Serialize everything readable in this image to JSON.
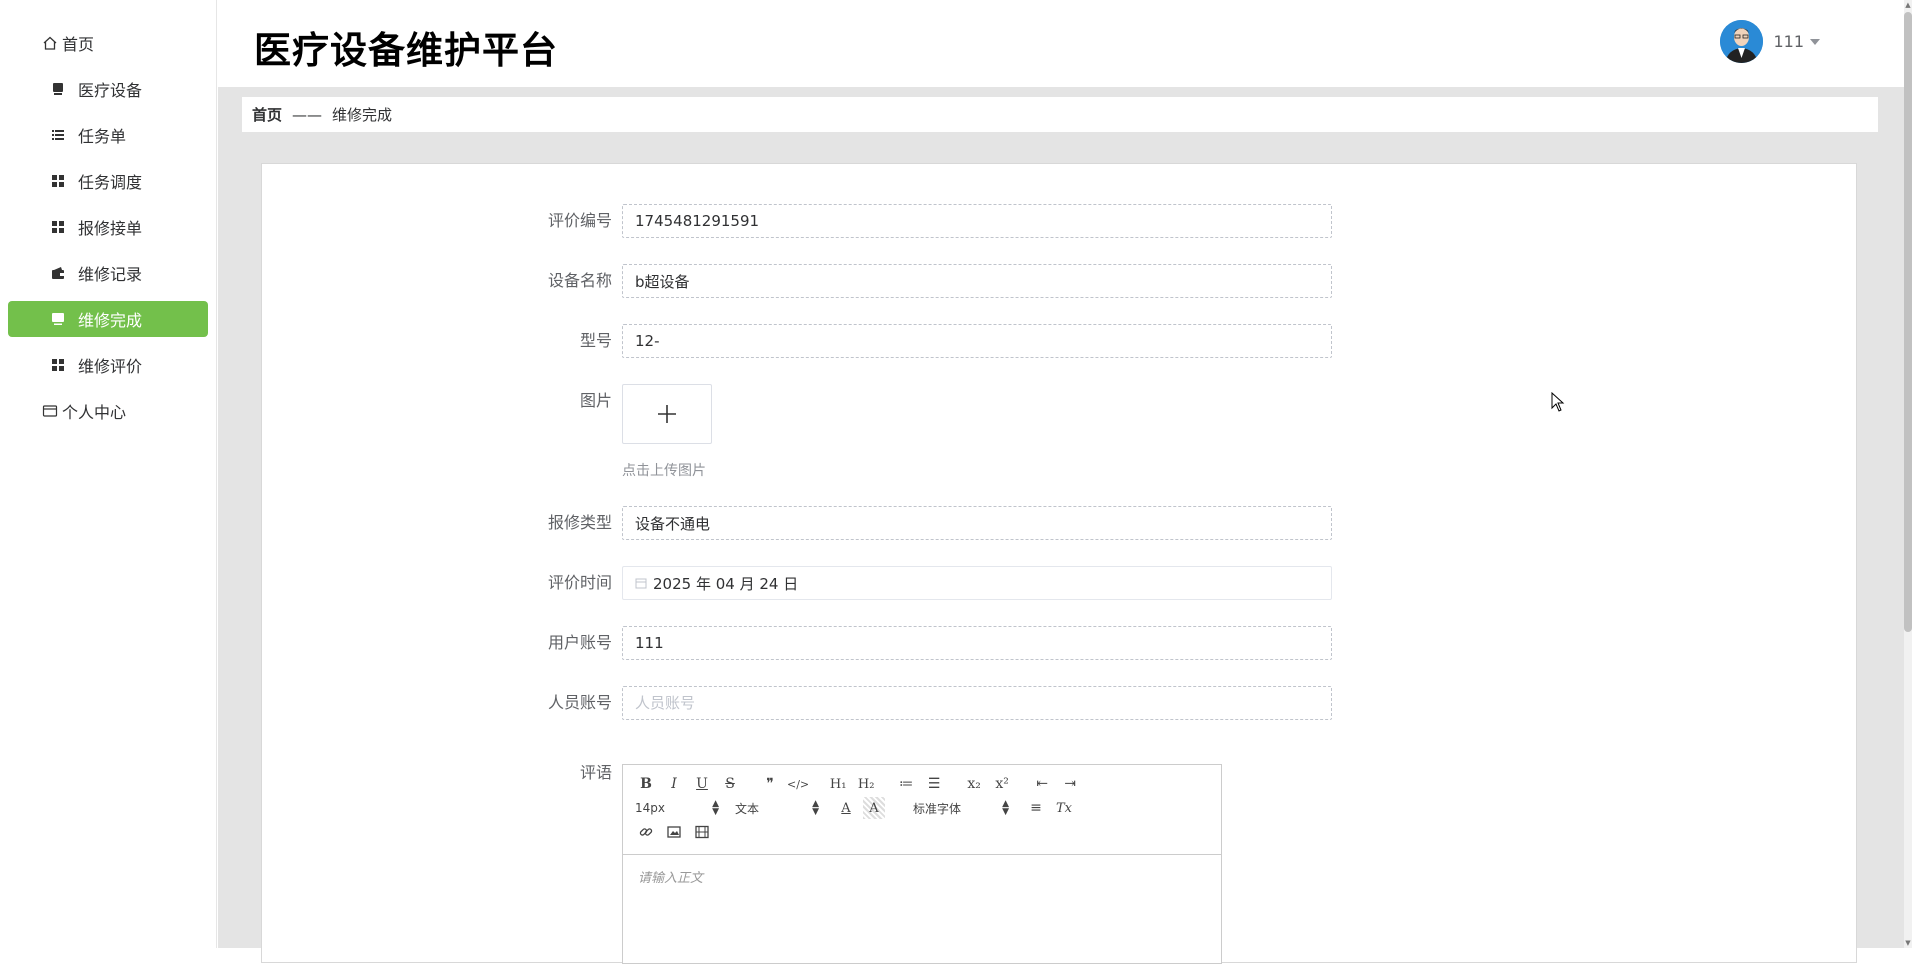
{
  "app": {
    "title": "医疗设备维护平台"
  },
  "user": {
    "name": "111"
  },
  "sidebar": {
    "items": [
      {
        "label": "首页",
        "icon": "home-icon",
        "type": "top"
      },
      {
        "label": "医疗设备",
        "icon": "device-icon",
        "type": "sub"
      },
      {
        "label": "任务单",
        "icon": "list-icon",
        "type": "sub"
      },
      {
        "label": "任务调度",
        "icon": "grid-icon",
        "type": "sub"
      },
      {
        "label": "报修接单",
        "icon": "grid-icon",
        "type": "sub"
      },
      {
        "label": "维修记录",
        "icon": "wallet-icon",
        "type": "sub"
      },
      {
        "label": "维修完成",
        "icon": "monitor-icon",
        "type": "sub",
        "active": true
      },
      {
        "label": "维修评价",
        "icon": "grid-icon",
        "type": "sub"
      },
      {
        "label": "个人中心",
        "icon": "card-icon",
        "type": "top"
      }
    ],
    "active_color": "#73c04b"
  },
  "breadcrumb": {
    "home": "首页",
    "separator": "——",
    "current": "维修完成"
  },
  "form": {
    "eval_no": {
      "label": "评价编号",
      "value": "1745481291591"
    },
    "device_name": {
      "label": "设备名称",
      "value": "b超设备"
    },
    "model": {
      "label": "型号",
      "value": "12-"
    },
    "image": {
      "label": "图片",
      "hint": "点击上传图片"
    },
    "repair_type": {
      "label": "报修类型",
      "value": "设备不通电"
    },
    "eval_time": {
      "label": "评价时间",
      "value": "2025 年 04 月 24 日"
    },
    "user_account": {
      "label": "用户账号",
      "value": "111"
    },
    "staff_account": {
      "label": "人员账号",
      "placeholder": "人员账号"
    },
    "comment": {
      "label": "评语"
    }
  },
  "editor": {
    "font_size": "14px",
    "block_type": "文本",
    "font_family": "标准字体",
    "placeholder": "请输入正文",
    "buttons": {
      "bold": "B",
      "italic": "I",
      "underline": "U",
      "strike": "S",
      "quote": "❞",
      "code": "</>",
      "h1": "H₁",
      "h2": "H₂",
      "ordered_list": "≔",
      "bullet_list": "☰",
      "subscript": "x₂",
      "superscript": "x²",
      "outdent": "⇤",
      "indent": "⇥",
      "color": "A",
      "background": "A",
      "align": "≡",
      "clean": "Tx"
    }
  }
}
